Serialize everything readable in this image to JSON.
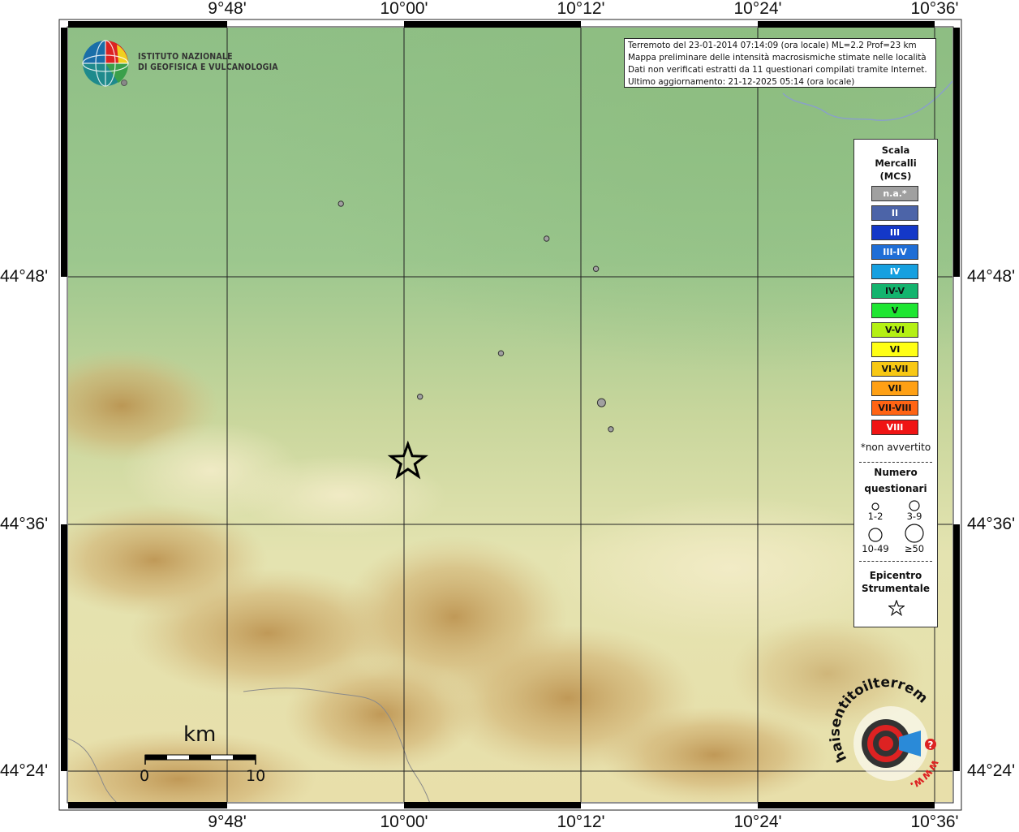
{
  "coordinates": {
    "top": [
      "9°48'",
      "10°00'",
      "10°12'",
      "10°24'",
      "10°36'"
    ],
    "bottom": [
      "9°48'",
      "10°00'",
      "10°12'",
      "10°24'",
      "10°36'"
    ],
    "left": [
      "44°48'",
      "44°36'",
      "44°24'"
    ],
    "right": [
      "44°48'",
      "44°36'",
      "44°24'"
    ]
  },
  "institute": {
    "line1": "ISTITUTO NAZIONALE",
    "line2": "DI GEOFISICA E VULCANOLOGIA"
  },
  "info_box": {
    "line1": "Terremoto del 23-01-2014 07:14:09 (ora locale) ML=2.2 Prof=23 km",
    "line2": "Mappa preliminare delle intensità macrosismiche stimate nelle località",
    "line3": "Dati non verificati estratti da 11 questionari compilati tramite Internet.",
    "line4": "Ultimo aggiornamento: 21-12-2025 05:14 (ora locale)"
  },
  "legend": {
    "title1": "Scala",
    "title2": "Mercalli",
    "title3": "(MCS)",
    "scale": [
      {
        "label": "n.a.*",
        "color": "#a0a0a0",
        "text_color": "#ffffff"
      },
      {
        "label": "II",
        "color": "#4c64a8",
        "text_color": "#ffffff"
      },
      {
        "label": "III",
        "color": "#1438c8",
        "text_color": "#ffffff"
      },
      {
        "label": "III-IV",
        "color": "#1f6ed6",
        "text_color": "#ffffff"
      },
      {
        "label": "IV",
        "color": "#16a0e0",
        "text_color": "#ffffff"
      },
      {
        "label": "IV-V",
        "color": "#14b46e",
        "text_color": "#111111"
      },
      {
        "label": "V",
        "color": "#1ee632",
        "text_color": "#111111"
      },
      {
        "label": "V-VI",
        "color": "#b4f014",
        "text_color": "#111111"
      },
      {
        "label": "VI",
        "color": "#ffff14",
        "text_color": "#111111"
      },
      {
        "label": "VI-VII",
        "color": "#f8c814",
        "text_color": "#111111"
      },
      {
        "label": "VII",
        "color": "#ffa014",
        "text_color": "#111111"
      },
      {
        "label": "VII-VIII",
        "color": "#ff6414",
        "text_color": "#111111"
      },
      {
        "label": "VIII",
        "color": "#f01414",
        "text_color": "#ffffff"
      }
    ],
    "na_note": "*non avvertito",
    "count_title1": "Numero",
    "count_title2": "questionari",
    "count_labels": [
      "1-2",
      "3-9",
      "10-49",
      "≥50"
    ],
    "epicenter_title1": "Epicentro",
    "epicenter_title2": "Strumentale"
  },
  "scale_bar": {
    "unit": "km",
    "start": "0",
    "end": "10"
  },
  "logo": {
    "text": "haisentitoilterremoto.it",
    "url_text": "www.",
    "question": "?"
  },
  "observations": [
    {
      "lon": 9.963,
      "lat": 44.846,
      "intensity": "n.a.*",
      "questionnaires": "1-2"
    },
    {
      "lon": 10.184,
      "lat": 44.817,
      "intensity": "n.a.*",
      "questionnaires": "1-2"
    },
    {
      "lon": 10.237,
      "lat": 44.792,
      "intensity": "n.a.*",
      "questionnaires": "1-2"
    },
    {
      "lon": 10.135,
      "lat": 44.722,
      "intensity": "n.a.*",
      "questionnaires": "1-2"
    },
    {
      "lon": 10.048,
      "lat": 44.686,
      "intensity": "n.a.*",
      "questionnaires": "1-2"
    },
    {
      "lon": 10.243,
      "lat": 44.681,
      "intensity": "n.a.*",
      "questionnaires": "3-9"
    },
    {
      "lon": 10.253,
      "lat": 44.659,
      "intensity": "n.a.*",
      "questionnaires": "1-2"
    }
  ],
  "epicenter": {
    "lon": 10.035,
    "lat": 44.632
  },
  "extent": {
    "lon_min": 9.67,
    "lon_max": 10.62,
    "lat_min": 44.35,
    "lat_max": 44.992
  }
}
